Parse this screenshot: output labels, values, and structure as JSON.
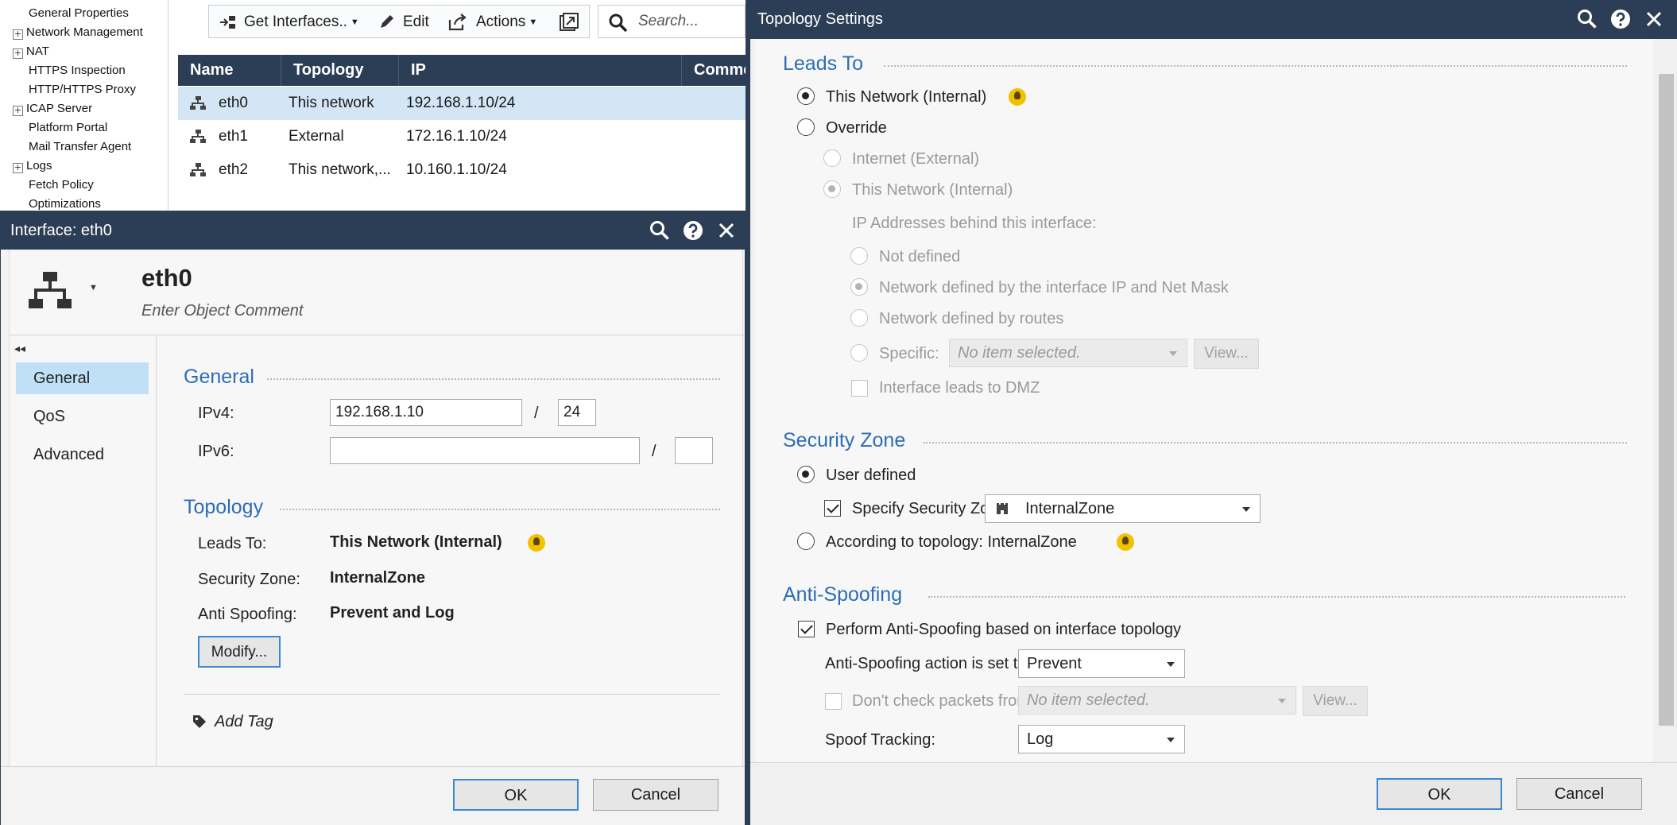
{
  "tree": {
    "items": [
      {
        "label": "General Properties",
        "expandable": false
      },
      {
        "label": "Network Management",
        "expandable": true
      },
      {
        "label": "NAT",
        "expandable": true
      },
      {
        "label": "HTTPS Inspection",
        "expandable": false
      },
      {
        "label": "HTTP/HTTPS Proxy",
        "expandable": false
      },
      {
        "label": "ICAP Server",
        "expandable": true
      },
      {
        "label": "Platform Portal",
        "expandable": false
      },
      {
        "label": "Mail Transfer Agent",
        "expandable": false
      },
      {
        "label": "Logs",
        "expandable": true
      },
      {
        "label": "Fetch Policy",
        "expandable": false
      },
      {
        "label": "Optimizations",
        "expandable": false
      }
    ]
  },
  "toolbar": {
    "get_interfaces": "Get Interfaces..",
    "edit": "Edit",
    "actions": "Actions",
    "search_placeholder": "Search..."
  },
  "grid": {
    "columns": [
      "Name",
      "Topology",
      "IP",
      "Comme"
    ],
    "rows": [
      {
        "name": "eth0",
        "topology": "This network",
        "ip": "192.168.1.10/24"
      },
      {
        "name": "eth1",
        "topology": "External",
        "ip": "172.16.1.10/24"
      },
      {
        "name": "eth2",
        "topology": "This network,...",
        "ip": "10.160.1.10/24"
      }
    ]
  },
  "interface_dialog": {
    "title": "Interface: eth0",
    "name": "eth0",
    "comment_placeholder": "Enter Object Comment",
    "nav": [
      "General",
      "QoS",
      "Advanced"
    ],
    "general": {
      "title": "General",
      "ipv4_label": "IPv4:",
      "ipv4_value": "192.168.1.10",
      "ipv4_mask": "24",
      "ipv6_label": "IPv6:",
      "ipv6_value": "",
      "ipv6_mask": "",
      "slash": "/"
    },
    "topology": {
      "title": "Topology",
      "leads_to_label": "Leads To:",
      "leads_to_value": "This Network (Internal)",
      "zone_label": "Security Zone:",
      "zone_value": "InternalZone",
      "spoof_label": "Anti Spoofing:",
      "spoof_value": "Prevent and Log",
      "modify_button": "Modify..."
    },
    "add_tag": "Add Tag",
    "ok": "OK",
    "cancel": "Cancel"
  },
  "topology_dialog": {
    "title": "Topology Settings",
    "leads_to": {
      "title": "Leads To",
      "this_network": "This Network (Internal)",
      "override": "Override",
      "internet_external": "Internet (External)",
      "this_network_internal": "This Network (Internal)",
      "ip_behind": "IP Addresses behind this interface:",
      "not_defined": "Not defined",
      "network_by_ip": "Network defined by the interface IP and Net Mask",
      "network_by_routes": "Network defined by routes",
      "specific": "Specific:",
      "specific_value": "No item selected.",
      "view": "View...",
      "dmz": "Interface leads to DMZ"
    },
    "security_zone": {
      "title": "Security Zone",
      "user_defined": "User defined",
      "specify_label": "Specify Security Zone:",
      "zone_value": "InternalZone",
      "according": "According to topology: InternalZone"
    },
    "anti_spoofing": {
      "title": "Anti-Spoofing",
      "perform": "Perform Anti-Spoofing based on interface topology",
      "action_label": "Anti-Spoofing action is set to",
      "action_value": "Prevent",
      "dont_check": "Don't check packets from:",
      "dont_check_value": "No item selected.",
      "view": "View...",
      "tracking_label": "Spoof Tracking:",
      "tracking_value": "Log"
    },
    "ok": "OK",
    "cancel": "Cancel"
  }
}
